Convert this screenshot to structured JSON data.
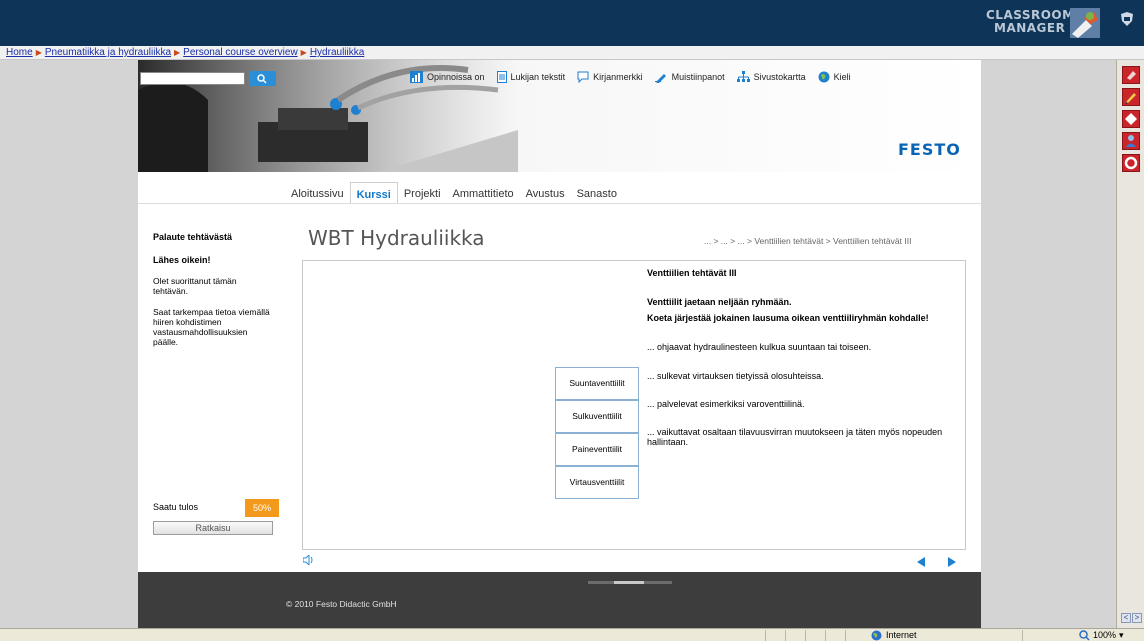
{
  "classroom_manager": {
    "line1": "CLASSROOM",
    "line2": "MANAGER"
  },
  "breadcrumb": [
    "Home",
    "Pneumatiikka ja hydrauliikka",
    "Personal course overview",
    "Hydrauliikka"
  ],
  "header": {
    "toplinks": [
      "Opinnoissa on",
      "Lukijan tekstit",
      "Kirjanmerkki",
      "Muistiinpanot",
      "Sivustokartta",
      "Kieli"
    ],
    "brand": "FESTO"
  },
  "nav": {
    "tabs": [
      "Aloitussivu",
      "Kurssi",
      "Projekti",
      "Ammattitieto",
      "Avustus",
      "Sanasto"
    ],
    "active": "Kurssi"
  },
  "module": {
    "title": "WBT Hydrauliikka",
    "crumb": "... > ... > ... > Venttiilien tehtävät > Venttiilien tehtävät III"
  },
  "left_panel": {
    "title": "Palaute tehtävästä",
    "result": "Lähes oikein!",
    "p1": "Olet suorittanut tämän tehtävän.",
    "p2": "Saat tarkempaa tietoa viemällä hiiren kohdistimen vastausmahdollisuuksien päälle.",
    "score_label": "Saatu tulos",
    "score_value": "50%",
    "solution_button": "Ratkaisu"
  },
  "exercise": {
    "title": "Venttiilien tehtävät III",
    "intro1": "Venttiilit jaetaan neljään ryhmään.",
    "intro2": "Koeta järjestää jokainen lausuma oikean venttiiliryhmän kohdalle!",
    "statements": [
      "... ohjaavat hydraulinesteen kulkua suuntaan tai toiseen.",
      "... sulkevat virtauksen tietyissä olosuhteissa.",
      "... palvelevat esimerkiksi varoventtiilinä.",
      "... vaikuttavat osaltaan tilavuusvirran muutokseen ja täten myös nopeuden hallintaan."
    ],
    "valve_boxes": [
      "Suuntaventtiilit",
      "Sulkuventtiilit",
      "Paineventtiilit",
      "Virtausventtiilit"
    ]
  },
  "footer": {
    "copyright": "© 2010 Festo Didactic GmbH"
  },
  "statusbar": {
    "zone": "Internet",
    "zoom": "100%"
  },
  "colors": {
    "topbar": "#0e3557",
    "festo_blue": "#0a64b4",
    "score_orange": "#f39a1c",
    "link_blue": "#1a2fa8",
    "footer": "#3d3d3d"
  }
}
